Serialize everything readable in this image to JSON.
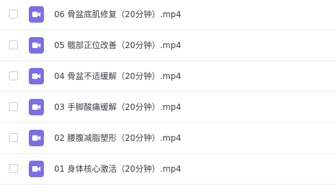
{
  "files": [
    {
      "name": "06 骨盆底肌修复（20分钟）.mp4",
      "icon": "video-file-icon"
    },
    {
      "name": "05 髋部正位改善（20分钟）.mp4",
      "icon": "video-file-icon"
    },
    {
      "name": "04 骨盆不适缓解（20分钟）.mp4",
      "icon": "video-file-icon"
    },
    {
      "name": "03 手脚酸痛缓解（20分钟）.mp4",
      "icon": "video-file-icon"
    },
    {
      "name": "02 腰腹减脂塑形（20分钟）.mp4",
      "icon": "video-file-icon"
    },
    {
      "name": "01 身体核心激活（20分钟）.mp4",
      "icon": "video-file-icon"
    }
  ],
  "colors": {
    "icon_bg": "#7b6fe8",
    "text": "#3a3d45",
    "divider": "#eceef2"
  }
}
